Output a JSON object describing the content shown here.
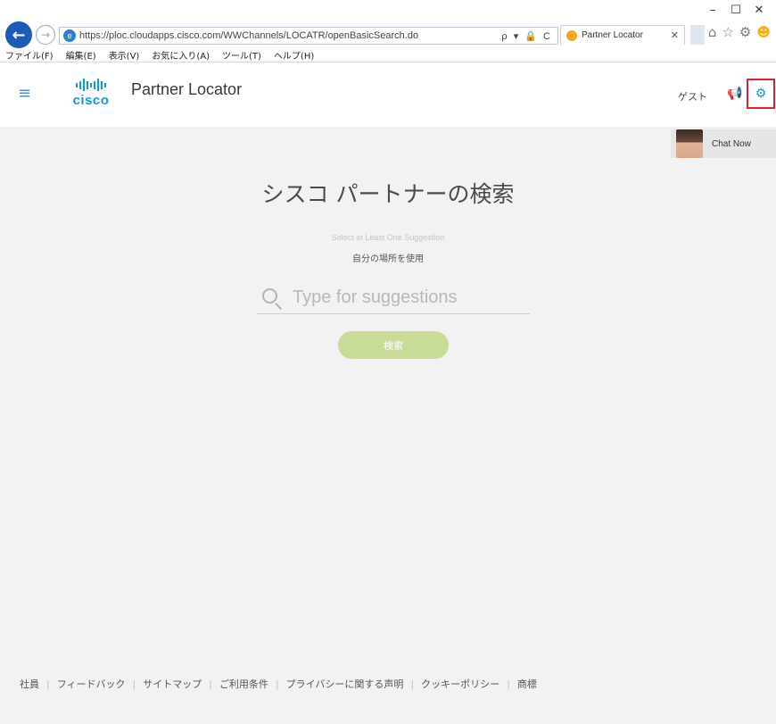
{
  "browser": {
    "url": "https://ploc.cloudapps.cisco.com/WWChannels/LOCATR/openBasicSearch.do",
    "tab_title": "Partner Locator",
    "addr_tools": "ρ ▾ 🔒 C",
    "menu": [
      "ファイル(F)",
      "編集(E)",
      "表示(V)",
      "お気に入り(A)",
      "ツール(T)",
      "ヘルプ(H)"
    ],
    "window_controls": [
      "–",
      "☐",
      "✕"
    ]
  },
  "header": {
    "logo_text": "cisco",
    "title": "Partner Locator",
    "guest": "ゲスト"
  },
  "chat": {
    "label": "Chat Now"
  },
  "main": {
    "title": "シスコ パートナーの検索",
    "hint": "Select at Least One Suggestion",
    "use_location": "自分の場所を使用",
    "search_placeholder": "Type for suggestions",
    "search_button": "検索"
  },
  "footer": {
    "links": [
      "社員",
      "フィードバック",
      "サイトマップ",
      "ご利用条件",
      "プライバシーに関する声明",
      "クッキーポリシー",
      "商標"
    ]
  },
  "colors": {
    "accent": "#049fd9",
    "search_button": "#c9dc97",
    "highlight_box": "#e0202a"
  }
}
